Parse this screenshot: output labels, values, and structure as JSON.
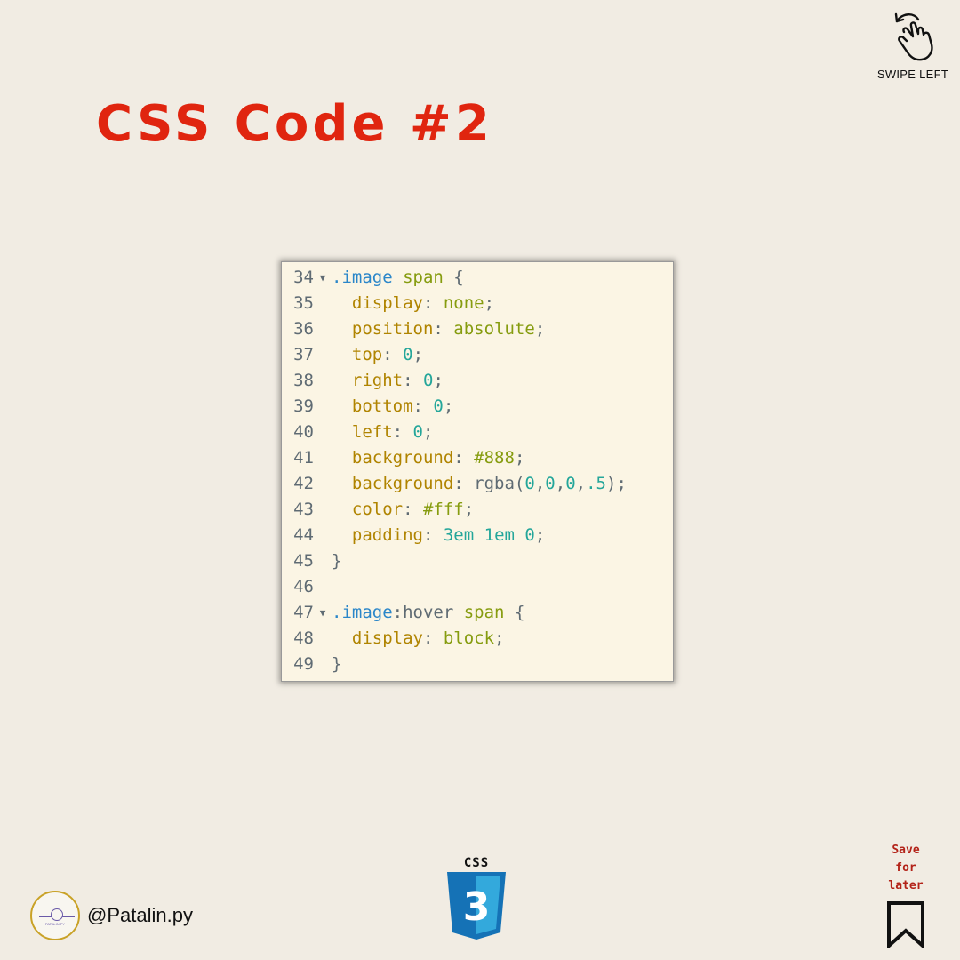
{
  "colors": {
    "background": "#f1ece3",
    "title": "#e0250f",
    "code_background": "#fbf5e4"
  },
  "header": {
    "title": "CSS Code #2",
    "swipe": {
      "icon": "hand-swipe-icon",
      "label": "SWIPE LEFT"
    }
  },
  "code": {
    "lines": [
      {
        "num": "34",
        "fold": true,
        "tokens": [
          [
            "sel",
            ".image"
          ],
          [
            "p",
            " "
          ],
          [
            "tag",
            "span"
          ],
          [
            "p",
            " {"
          ]
        ]
      },
      {
        "num": "35",
        "fold": false,
        "tokens": [
          [
            "p",
            "  "
          ],
          [
            "prop",
            "display"
          ],
          [
            "p",
            ": "
          ],
          [
            "val",
            "none"
          ],
          [
            "p",
            ";"
          ]
        ]
      },
      {
        "num": "36",
        "fold": false,
        "tokens": [
          [
            "p",
            "  "
          ],
          [
            "prop",
            "position"
          ],
          [
            "p",
            ": "
          ],
          [
            "val",
            "absolute"
          ],
          [
            "p",
            ";"
          ]
        ]
      },
      {
        "num": "37",
        "fold": false,
        "tokens": [
          [
            "p",
            "  "
          ],
          [
            "prop",
            "top"
          ],
          [
            "p",
            ": "
          ],
          [
            "num",
            "0"
          ],
          [
            "p",
            ";"
          ]
        ]
      },
      {
        "num": "38",
        "fold": false,
        "tokens": [
          [
            "p",
            "  "
          ],
          [
            "prop",
            "right"
          ],
          [
            "p",
            ": "
          ],
          [
            "num",
            "0"
          ],
          [
            "p",
            ";"
          ]
        ]
      },
      {
        "num": "39",
        "fold": false,
        "tokens": [
          [
            "p",
            "  "
          ],
          [
            "prop",
            "bottom"
          ],
          [
            "p",
            ": "
          ],
          [
            "num",
            "0"
          ],
          [
            "p",
            ";"
          ]
        ]
      },
      {
        "num": "40",
        "fold": false,
        "tokens": [
          [
            "p",
            "  "
          ],
          [
            "prop",
            "left"
          ],
          [
            "p",
            ": "
          ],
          [
            "num",
            "0"
          ],
          [
            "p",
            ";"
          ]
        ]
      },
      {
        "num": "41",
        "fold": false,
        "tokens": [
          [
            "p",
            "  "
          ],
          [
            "prop",
            "background"
          ],
          [
            "p",
            ": "
          ],
          [
            "val",
            "#888"
          ],
          [
            "p",
            ";"
          ]
        ]
      },
      {
        "num": "42",
        "fold": false,
        "tokens": [
          [
            "p",
            "  "
          ],
          [
            "prop",
            "background"
          ],
          [
            "p",
            ": "
          ],
          [
            "fn",
            "rgba("
          ],
          [
            "num",
            "0"
          ],
          [
            "p",
            ","
          ],
          [
            "num",
            "0"
          ],
          [
            "p",
            ","
          ],
          [
            "num",
            "0"
          ],
          [
            "p",
            ","
          ],
          [
            "num",
            ".5"
          ],
          [
            "fn",
            ")"
          ],
          [
            "p",
            ";"
          ]
        ]
      },
      {
        "num": "43",
        "fold": false,
        "tokens": [
          [
            "p",
            "  "
          ],
          [
            "prop",
            "color"
          ],
          [
            "p",
            ": "
          ],
          [
            "val",
            "#fff"
          ],
          [
            "p",
            ";"
          ]
        ]
      },
      {
        "num": "44",
        "fold": false,
        "tokens": [
          [
            "p",
            "  "
          ],
          [
            "prop",
            "padding"
          ],
          [
            "p",
            ": "
          ],
          [
            "num",
            "3em"
          ],
          [
            "p",
            " "
          ],
          [
            "num",
            "1em"
          ],
          [
            "p",
            " "
          ],
          [
            "num",
            "0"
          ],
          [
            "p",
            ";"
          ]
        ]
      },
      {
        "num": "45",
        "fold": false,
        "tokens": [
          [
            "p",
            "}"
          ]
        ]
      },
      {
        "num": "46",
        "fold": false,
        "tokens": []
      },
      {
        "num": "47",
        "fold": true,
        "tokens": [
          [
            "sel",
            ".image"
          ],
          [
            "pseudo",
            ":hover"
          ],
          [
            "p",
            " "
          ],
          [
            "tag",
            "span"
          ],
          [
            "p",
            " {"
          ]
        ]
      },
      {
        "num": "48",
        "fold": false,
        "tokens": [
          [
            "p",
            "  "
          ],
          [
            "prop",
            "display"
          ],
          [
            "p",
            ": "
          ],
          [
            "val",
            "block"
          ],
          [
            "p",
            ";"
          ]
        ]
      },
      {
        "num": "49",
        "fold": false,
        "tokens": [
          [
            "p",
            "}"
          ]
        ]
      }
    ]
  },
  "footer": {
    "handle": "@Patalin.py",
    "avatar_text": "PATALIN.PY",
    "css_logo_label": "CSS",
    "css_logo_digit": "3",
    "save_label": "Save\nfor\nlater",
    "save_icon": "bookmark-icon"
  }
}
